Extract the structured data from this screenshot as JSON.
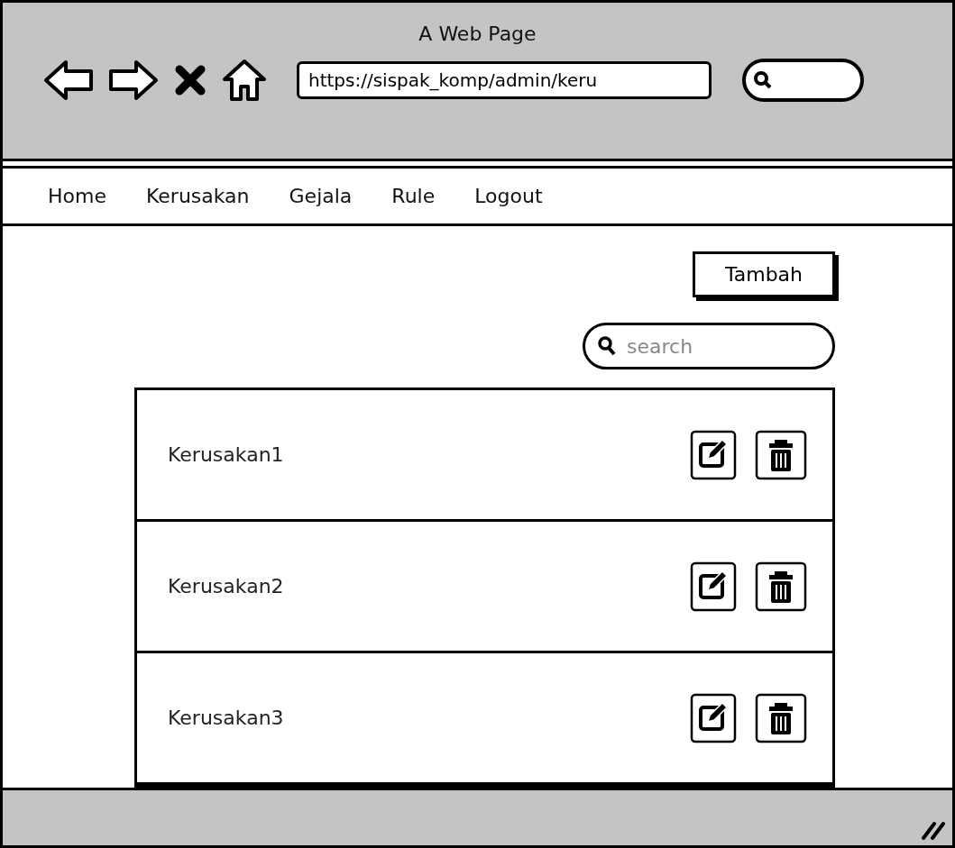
{
  "window": {
    "title": "A Web Page"
  },
  "address_bar": {
    "value": "https://sispak_komp/admin/keru"
  },
  "nav": [
    {
      "label": "Home"
    },
    {
      "label": "Kerusakan"
    },
    {
      "label": "Gejala"
    },
    {
      "label": "Rule"
    },
    {
      "label": "Logout"
    }
  ],
  "add_button": {
    "label": "Tambah"
  },
  "search": {
    "placeholder": "search"
  },
  "rows": [
    {
      "name": "Kerusakan1"
    },
    {
      "name": "Kerusakan2"
    },
    {
      "name": "Kerusakan3"
    }
  ]
}
